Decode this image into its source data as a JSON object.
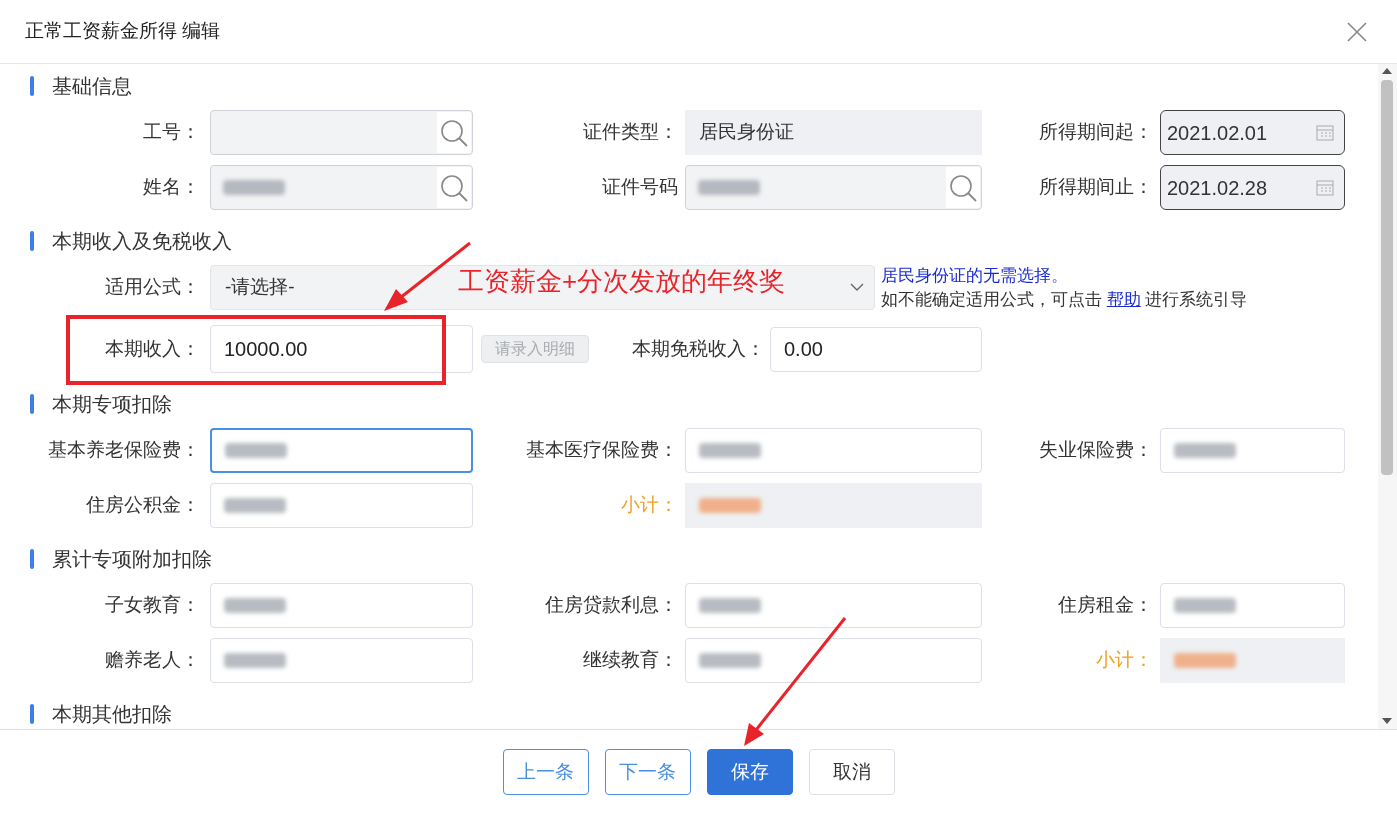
{
  "window": {
    "title": "正常工资薪金所得 编辑"
  },
  "sections": [
    {
      "title": "基础信息",
      "rows": [
        {
          "kind": "fields",
          "cells": [
            {
              "label": "工号：",
              "kind": "lookup"
            },
            {
              "label": "证件类型：",
              "kind": "readonly",
              "value": "居民身份证"
            },
            {
              "label": "所得期间起：",
              "kind": "date",
              "value": "2021.02.01"
            }
          ]
        },
        {
          "kind": "fields",
          "cells": [
            {
              "label": "姓名：",
              "kind": "lookup",
              "blurred": true
            },
            {
              "label": "证件号码",
              "kind": "lookup",
              "blurred": true
            },
            {
              "label": "所得期间止：",
              "kind": "date",
              "value": "2021.02.28"
            }
          ]
        }
      ]
    },
    {
      "title": "本期收入及免税收入",
      "rows": [
        {
          "kind": "formula",
          "label": "适用公式：",
          "value": "-请选择-",
          "hint": "居民身份证的无需选择。",
          "help": {
            "before": "如不能确定适用公式，可点击",
            "link": "帮助",
            "after": "进行系统引导"
          }
        },
        {
          "kind": "income",
          "cells": [
            {
              "label": "本期收入：",
              "kind": "input",
              "value": "10000.00",
              "focused": false
            },
            {
              "label": "本期免税收入：",
              "kind": "input",
              "value": "0.00",
              "focused": false
            }
          ],
          "button": {
            "label": "请录入明细",
            "disabled": true
          }
        }
      ]
    },
    {
      "title": "本期专项扣除",
      "rows": [
        {
          "kind": "fields",
          "cells": [
            {
              "label": "基本养老保险费：",
              "kind": "input",
              "blurred": true,
              "focused": true
            },
            {
              "label": "基本医疗保险费：",
              "kind": "input",
              "blurred": true,
              "focused": false
            },
            {
              "label": "失业保险费：",
              "kind": "input",
              "blurred": true,
              "focused": false
            }
          ]
        },
        {
          "kind": "fields",
          "cells": [
            {
              "label": "住房公积金：",
              "kind": "input",
              "blurred": true,
              "focused": false
            },
            {
              "label": "小计：",
              "kind": "subtotal",
              "blurred": true
            }
          ]
        }
      ]
    },
    {
      "title": "累计专项附加扣除",
      "rows": [
        {
          "kind": "fields",
          "cells": [
            {
              "label": "子女教育：",
              "kind": "input",
              "blurred": true,
              "focused": false
            },
            {
              "label": "住房贷款利息：",
              "kind": "input",
              "blurred": true,
              "focused": false
            },
            {
              "label": "住房租金：",
              "kind": "input",
              "blurred": true,
              "focused": false
            }
          ]
        },
        {
          "kind": "fields",
          "cells": [
            {
              "label": "赡养老人：",
              "kind": "input",
              "blurred": true,
              "focused": false
            },
            {
              "label": "继续教育：",
              "kind": "input",
              "blurred": true,
              "focused": false
            },
            {
              "label": "小计：",
              "kind": "subtotal",
              "blurred": true
            }
          ]
        }
      ]
    },
    {
      "title": "本期其他扣除"
    }
  ],
  "buttons": [
    {
      "label": "上一条",
      "kind": "outline"
    },
    {
      "label": "下一条",
      "kind": "outline"
    },
    {
      "label": "保存",
      "kind": "primary"
    },
    {
      "label": "取消",
      "kind": "default"
    }
  ],
  "annotation": {
    "text": "工资薪金+分次发放的年终奖"
  }
}
